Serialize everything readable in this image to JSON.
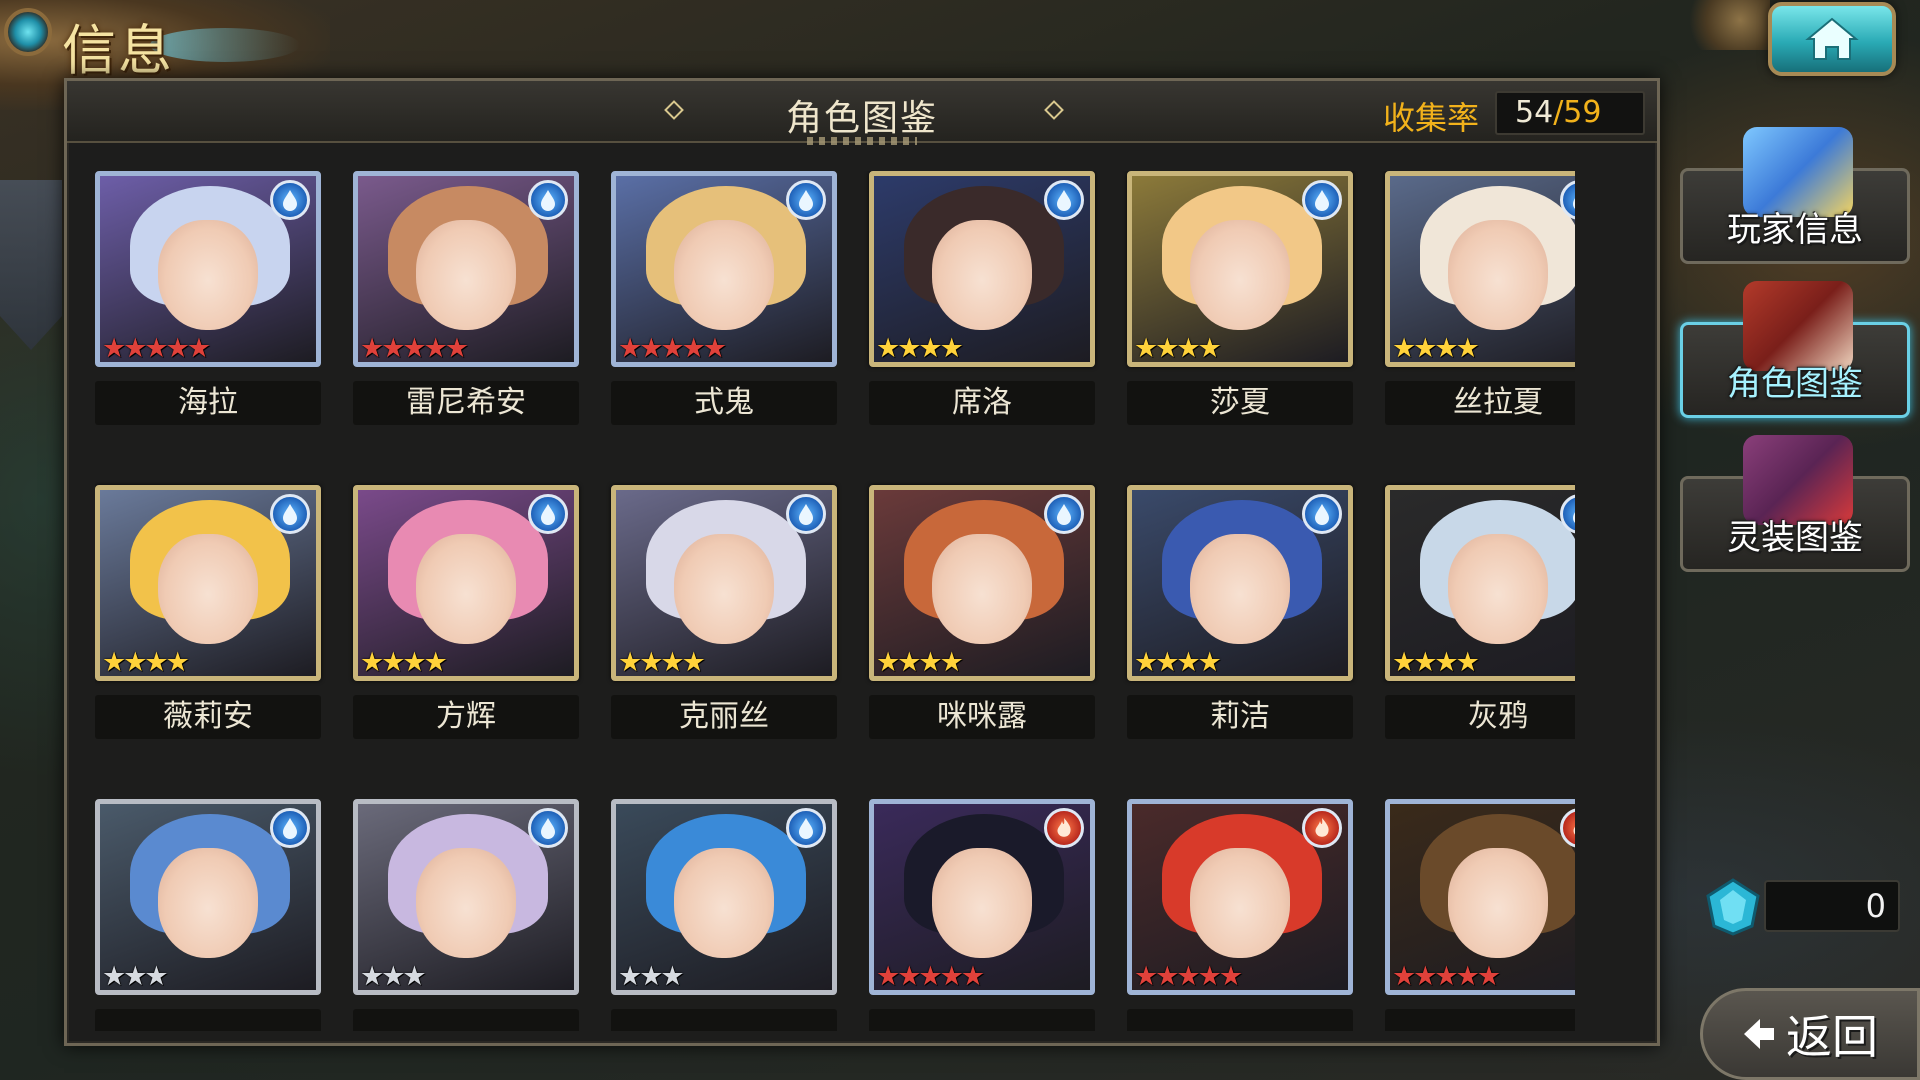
{
  "header": {
    "title": "信息",
    "home_icon": "home-icon"
  },
  "panel": {
    "title": "角色图鉴",
    "collection_label": "收集率",
    "collected": "54",
    "separator": "/",
    "total": "59"
  },
  "characters": [
    {
      "name": "海拉",
      "element": "water",
      "stars": "★★★★★",
      "rarity": "red",
      "frame": "blue"
    },
    {
      "name": "雷尼希安",
      "element": "water",
      "stars": "★★★★★",
      "rarity": "red",
      "frame": "blue"
    },
    {
      "name": "式鬼",
      "element": "water",
      "stars": "★★★★★",
      "rarity": "red",
      "frame": "blue"
    },
    {
      "name": "席洛",
      "element": "water",
      "stars": "★★★★",
      "rarity": "gold",
      "frame": "gold"
    },
    {
      "name": "莎夏",
      "element": "water",
      "stars": "★★★★",
      "rarity": "gold",
      "frame": "gold"
    },
    {
      "name": "丝拉夏",
      "element": "water",
      "stars": "★★★★",
      "rarity": "gold",
      "frame": "gold"
    },
    {
      "name": "薇莉安",
      "element": "water",
      "stars": "★★★★",
      "rarity": "gold",
      "frame": "gold"
    },
    {
      "name": "方辉",
      "element": "water",
      "stars": "★★★★",
      "rarity": "gold",
      "frame": "gold"
    },
    {
      "name": "克丽丝",
      "element": "water",
      "stars": "★★★★",
      "rarity": "gold",
      "frame": "gold"
    },
    {
      "name": "咪咪露",
      "element": "water",
      "stars": "★★★★",
      "rarity": "gold",
      "frame": "gold"
    },
    {
      "name": "莉洁",
      "element": "water",
      "stars": "★★★★",
      "rarity": "gold",
      "frame": "gold"
    },
    {
      "name": "灰鸦",
      "element": "water",
      "stars": "★★★★",
      "rarity": "gold",
      "frame": "gold"
    },
    {
      "name": "",
      "element": "water",
      "stars": "★★★",
      "rarity": "silver",
      "frame": "silver"
    },
    {
      "name": "",
      "element": "water",
      "stars": "★★★",
      "rarity": "silver",
      "frame": "silver"
    },
    {
      "name": "",
      "element": "water",
      "stars": "★★★",
      "rarity": "silver",
      "frame": "silver"
    },
    {
      "name": "",
      "element": "fire",
      "stars": "★★★★★",
      "rarity": "red",
      "frame": "blue"
    },
    {
      "name": "",
      "element": "fire",
      "stars": "★★★★★",
      "rarity": "red",
      "frame": "blue"
    },
    {
      "name": "",
      "element": "fire",
      "stars": "★★★★★",
      "rarity": "red",
      "frame": "blue"
    }
  ],
  "sidebar": {
    "items": [
      {
        "label": "玩家信息",
        "active": false
      },
      {
        "label": "角色图鉴",
        "active": true
      },
      {
        "label": "灵装图鉴",
        "active": false
      }
    ]
  },
  "currency": {
    "value": "0",
    "icon": "gem-icon"
  },
  "footer": {
    "return_label": "返回",
    "return_icon": "arrow-left-icon"
  },
  "colors": {
    "accent_gold": "#f2b21b",
    "active_cyan": "#6ad0e6",
    "water": "#1a5bb3",
    "fire": "#b3231a"
  }
}
